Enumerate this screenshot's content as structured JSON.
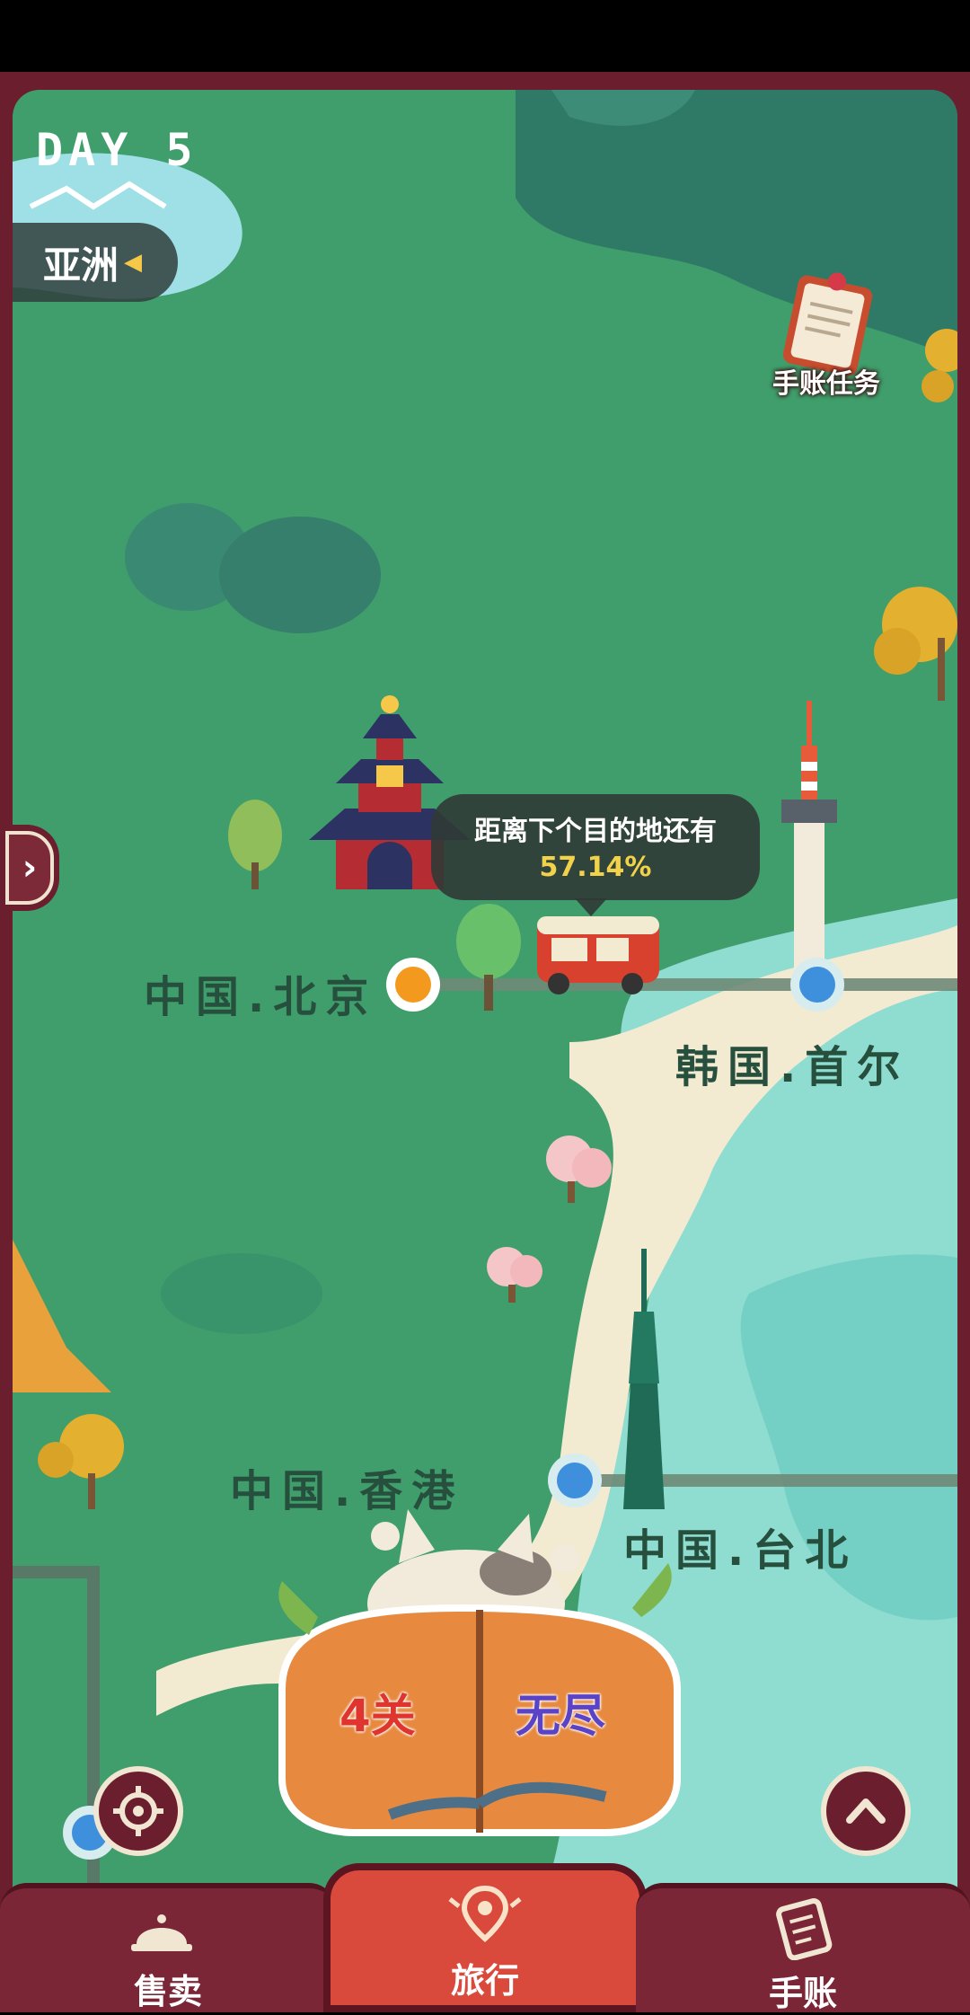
{
  "hud": {
    "day": "DAY 5",
    "region": "亚洲",
    "task_label": "手账任务"
  },
  "map": {
    "places": {
      "beijing": "中国.北京",
      "seoul": "韩国.首尔",
      "hongkong": "中国.香港",
      "taipei": "中国.台北"
    },
    "progress_title": "距离下个目的地还有",
    "progress_value": "57.14%",
    "progress_fraction": 0.5714
  },
  "modes": {
    "levels": "4关",
    "endless": "无尽"
  },
  "tabs": [
    {
      "label": "售卖",
      "icon": "bell-icon"
    },
    {
      "label": "旅行",
      "icon": "map-pin-icon"
    },
    {
      "label": "手账",
      "icon": "notebook-icon"
    }
  ],
  "colors": {
    "frame": "#6b1f2e",
    "land": "#3f9e6b",
    "sea": "#8fdcd0",
    "route": "#f3ead2",
    "active_tab": "#d94a3c",
    "progress": "#f2d24a"
  }
}
